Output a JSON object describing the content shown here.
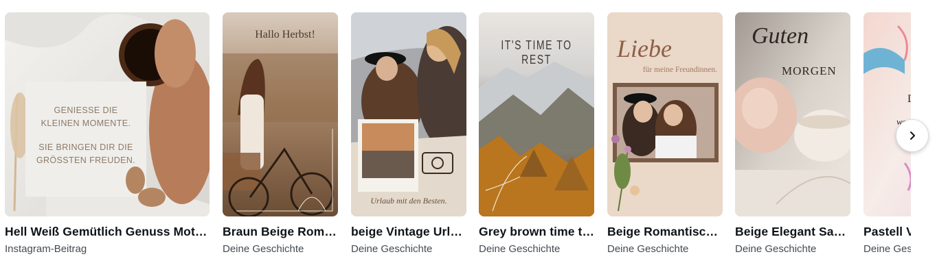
{
  "carousel": {
    "cards": [
      {
        "title": "Hell Weiß Gemütlich Genuss Motiva...",
        "subtitle": "Instagram-Beitrag",
        "design_text": [
          "GENIESSE DIE",
          "KLEINEN MOMENTE.",
          "SIE BRINGEN DIR DIE",
          "GRÖSSTEN FREUDEN."
        ]
      },
      {
        "title": "Braun Beige Roman...",
        "subtitle": "Deine Geschichte",
        "design_text": [
          "Hallo Herbst!"
        ]
      },
      {
        "title": "beige Vintage Urlau...",
        "subtitle": "Deine Geschichte",
        "design_text": [
          "Urlaub mit den Besten."
        ]
      },
      {
        "title": "Grey brown time to...",
        "subtitle": "Deine Geschichte",
        "design_text": [
          "IT'S TIME TO REST"
        ]
      },
      {
        "title": "Beige Romantisch ...",
        "subtitle": "Deine Geschichte",
        "design_text": [
          "Liebe",
          "für meine Freundinnen."
        ]
      },
      {
        "title": "Beige Elegant Sanft...",
        "subtitle": "Deine Geschichte",
        "design_text": [
          "Guten",
          "MORGEN"
        ]
      },
      {
        "title": "Pastell Vo",
        "subtitle": "Deine Gesc",
        "design_text": [
          "D",
          "wo"
        ]
      }
    ]
  },
  "controls": {
    "next_icon": "chevron-right-icon"
  },
  "colors": {
    "text_primary": "#0e1318",
    "text_secondary": "#444a51"
  }
}
